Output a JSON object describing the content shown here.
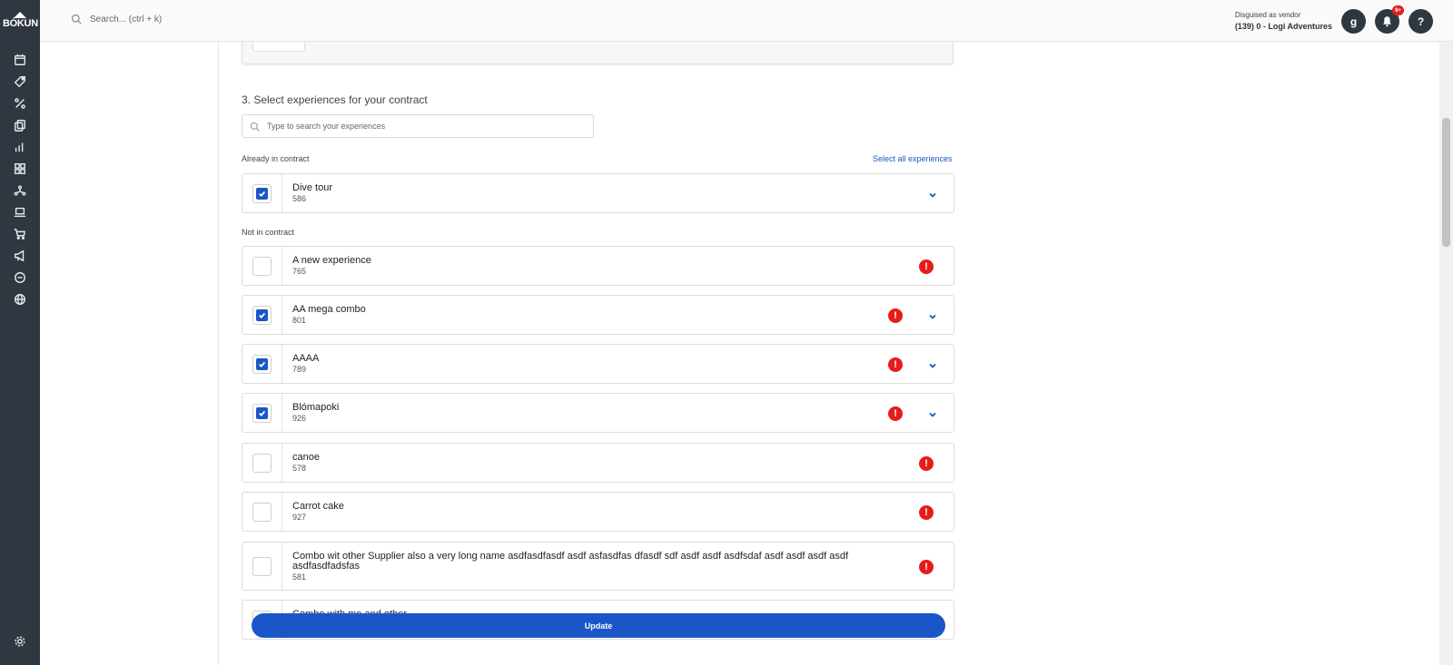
{
  "app": {
    "logo_text": "BÓKUN"
  },
  "sidebar": {
    "items": [
      {
        "icon": "calendar-icon"
      },
      {
        "icon": "tag-icon"
      },
      {
        "icon": "percent-icon"
      },
      {
        "icon": "copy-icon"
      },
      {
        "icon": "bar-chart-icon"
      },
      {
        "icon": "dashboard-icon"
      },
      {
        "icon": "network-icon"
      },
      {
        "icon": "laptop-icon"
      },
      {
        "icon": "cart-icon"
      },
      {
        "icon": "megaphone-icon"
      },
      {
        "icon": "chat-icon"
      },
      {
        "icon": "globe-icon"
      }
    ],
    "settings_icon": "gear-icon"
  },
  "topbar": {
    "search_placeholder": "Search... (ctrl + k)",
    "disguise_label": "Disguised as vendor",
    "vendor_name": "(139) 0 - Logi Adventures",
    "avatar_letter": "g",
    "notification_badge": "9+",
    "help_label": "?"
  },
  "main": {
    "section_title": "3. Select experiences for your contract",
    "search_placeholder": "Type to search your experiences",
    "already_label": "Already in contract",
    "select_all_label": "Select all experiences",
    "not_in_label": "Not in contract",
    "in_contract": [
      {
        "name": "Dive tour",
        "id": "586",
        "checked": true,
        "warning": false,
        "expandable": true
      }
    ],
    "not_in_contract": [
      {
        "name": "A new experience",
        "id": "765",
        "checked": false,
        "warning": true,
        "expandable": false
      },
      {
        "name": "AA mega combo",
        "id": "801",
        "checked": true,
        "warning": true,
        "expandable": true
      },
      {
        "name": "AAAA",
        "id": "789",
        "checked": true,
        "warning": true,
        "expandable": true
      },
      {
        "name": "Blómapoki",
        "id": "926",
        "checked": true,
        "warning": true,
        "expandable": true
      },
      {
        "name": "canoe",
        "id": "578",
        "checked": false,
        "warning": true,
        "expandable": false
      },
      {
        "name": "Carrot cake",
        "id": "927",
        "checked": false,
        "warning": true,
        "expandable": false
      },
      {
        "name": "Combo wit other Supplier also a very long name asdfasdfasdf asdf asfasdfas dfasdf sdf asdf asdf asdfsdaf asdf asdf asdf asdf asdfasdfadsfas",
        "id": "581",
        "checked": false,
        "warning": true,
        "expandable": false
      },
      {
        "name": "Combo with me and other",
        "id": "",
        "checked": false,
        "warning": true,
        "expandable": false
      }
    ],
    "warning_glyph": "!",
    "update_label": "Update"
  }
}
